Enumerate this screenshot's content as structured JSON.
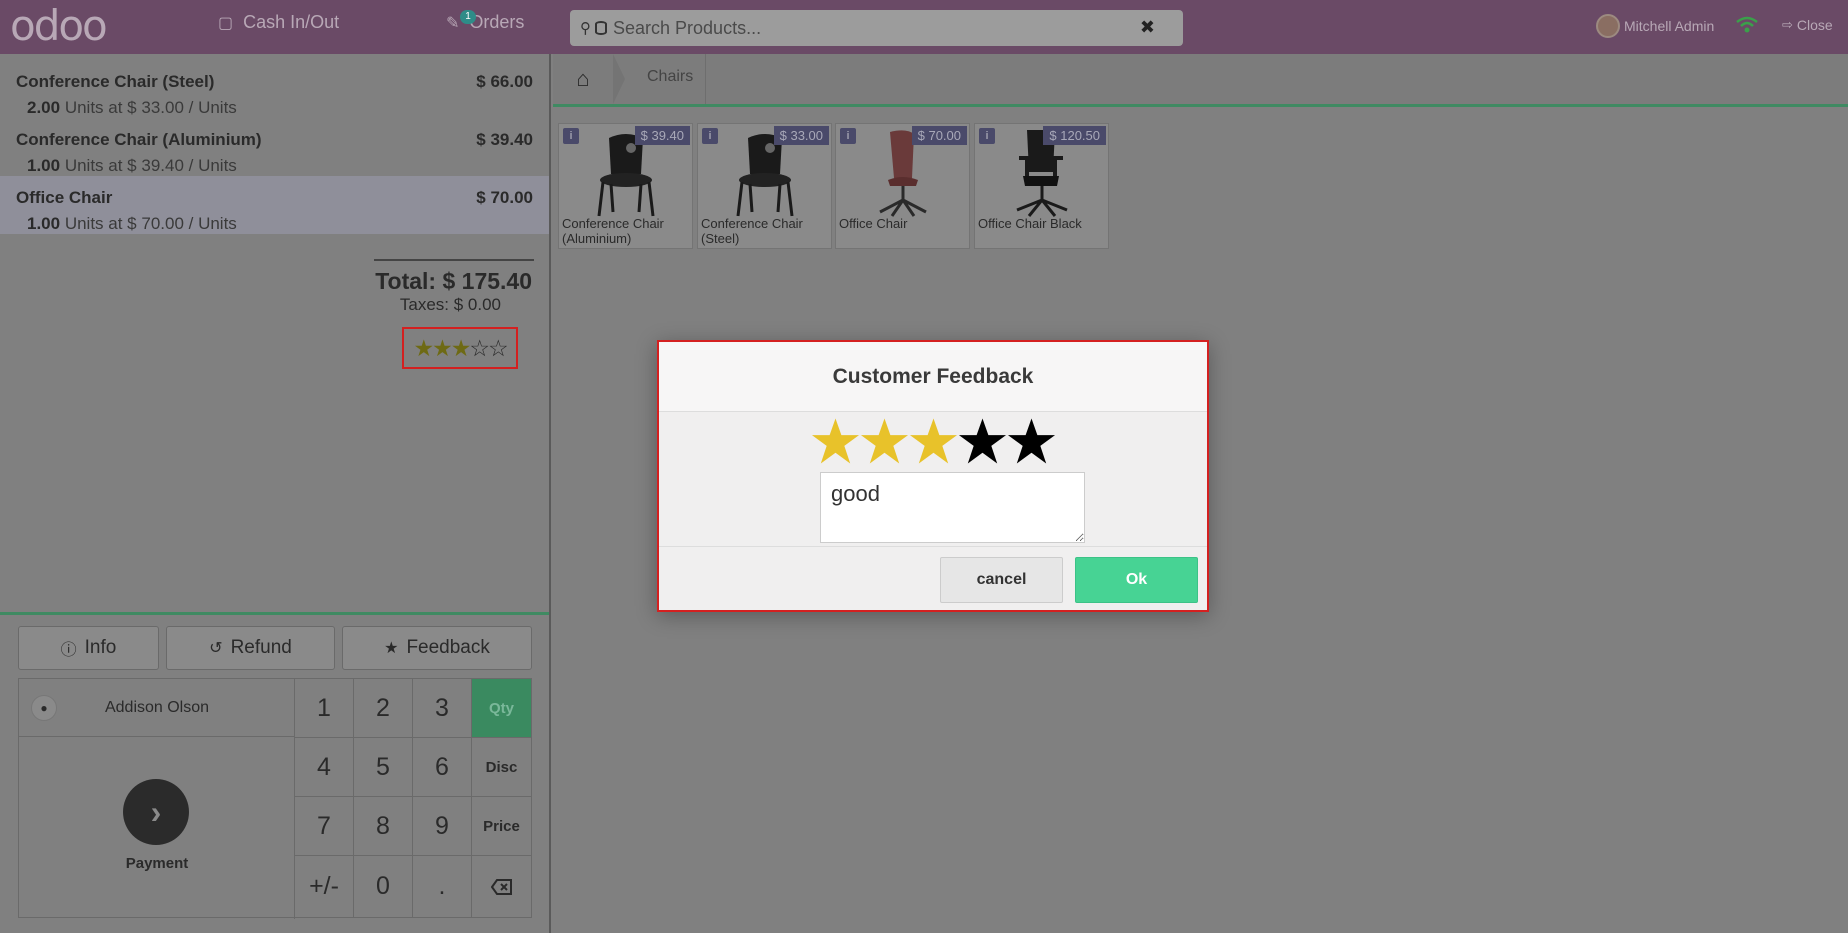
{
  "header": {
    "logo": "odoo",
    "cash_label": "Cash In/Out",
    "orders_label": "Orders",
    "orders_badge": "1",
    "search_placeholder": "Search Products...",
    "user_name": "Mitchell Admin",
    "close_label": "Close"
  },
  "order": {
    "lines": [
      {
        "name": "Conference Chair (Steel)",
        "price": "$ 66.00",
        "qty": "2.00",
        "unit_text": "Units at $ 33.00 / Units"
      },
      {
        "name": "Conference Chair (Aluminium)",
        "price": "$ 39.40",
        "qty": "1.00",
        "unit_text": "Units at $ 39.40 / Units"
      },
      {
        "name": "Office Chair",
        "price": "$ 70.00",
        "qty": "1.00",
        "unit_text": "Units at $ 70.00 / Units"
      }
    ],
    "total": "Total: $ 175.40",
    "taxes": "Taxes: $ 0.00",
    "rating": 3,
    "rating_max": 5
  },
  "controls": {
    "info": "Info",
    "refund": "Refund",
    "feedback": "Feedback",
    "customer": "Addison Olson",
    "payment": "Payment",
    "keys": [
      "1",
      "2",
      "3",
      "Qty",
      "4",
      "5",
      "6",
      "Disc",
      "7",
      "8",
      "9",
      "Price",
      "+/-",
      "0",
      "."
    ],
    "active_mode": "Qty"
  },
  "breadcrumb": {
    "category": "Chairs"
  },
  "products": [
    {
      "name": "Conference Chair (Aluminium)",
      "price": "$ 39.40"
    },
    {
      "name": "Conference Chair (Steel)",
      "price": "$ 33.00"
    },
    {
      "name": "Office Chair",
      "price": "$ 70.00"
    },
    {
      "name": "Office Chair Black",
      "price": "$ 120.50"
    }
  ],
  "modal": {
    "title": "Customer Feedback",
    "rating": 3,
    "rating_max": 5,
    "feedback_value": "good",
    "cancel": "cancel",
    "ok": "Ok",
    "colors": {
      "star_on": "#e8c22a",
      "star_off": "#000000",
      "ok": "#47d394"
    }
  }
}
